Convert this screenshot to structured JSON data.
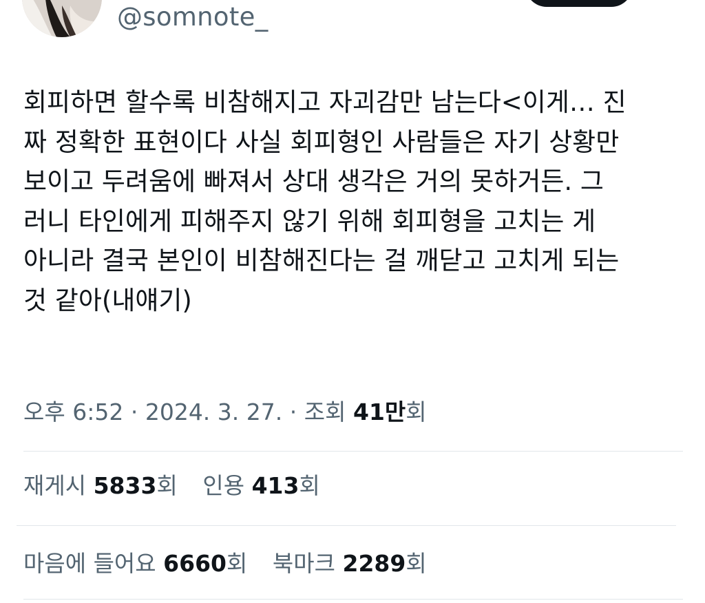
{
  "author": {
    "handle": "@somnote_"
  },
  "tweet": {
    "text": "회피하면 할수록 비참해지고 자괴감만 남는다<이게… 진\n짜 정확한 표현이다 사실 회피형인 사람들은 자기 상황만\n보이고 두려움에 빠져서 상대 생각은 거의 못하거든. 그\n러니 타인에게 피해주지 않기 위해 회피형을 고치는 게\n아니라 결국 본인이 비참해진다는 걸 깨닫고 고치게 되는\n것 같아(내얘기)"
  },
  "meta": {
    "time": "오후 6:52",
    "separator": "·",
    "date": "2024. 3. 27.",
    "views_label": "조회",
    "views_count": "41만",
    "views_suffix": "회"
  },
  "stats": {
    "retweets": {
      "label": "재게시",
      "count": "5833",
      "suffix": "회"
    },
    "quotes": {
      "label": "인용",
      "count": "413",
      "suffix": "회"
    },
    "likes": {
      "label": "마음에 들어요",
      "count": "6660",
      "suffix": "회"
    },
    "bookmarks": {
      "label": "북마크",
      "count": "2289",
      "suffix": "회"
    }
  },
  "colors": {
    "text_primary": "#0f1419",
    "text_secondary": "#536471",
    "divider": "#e1e6ea",
    "follow_button": "#0f1419"
  }
}
